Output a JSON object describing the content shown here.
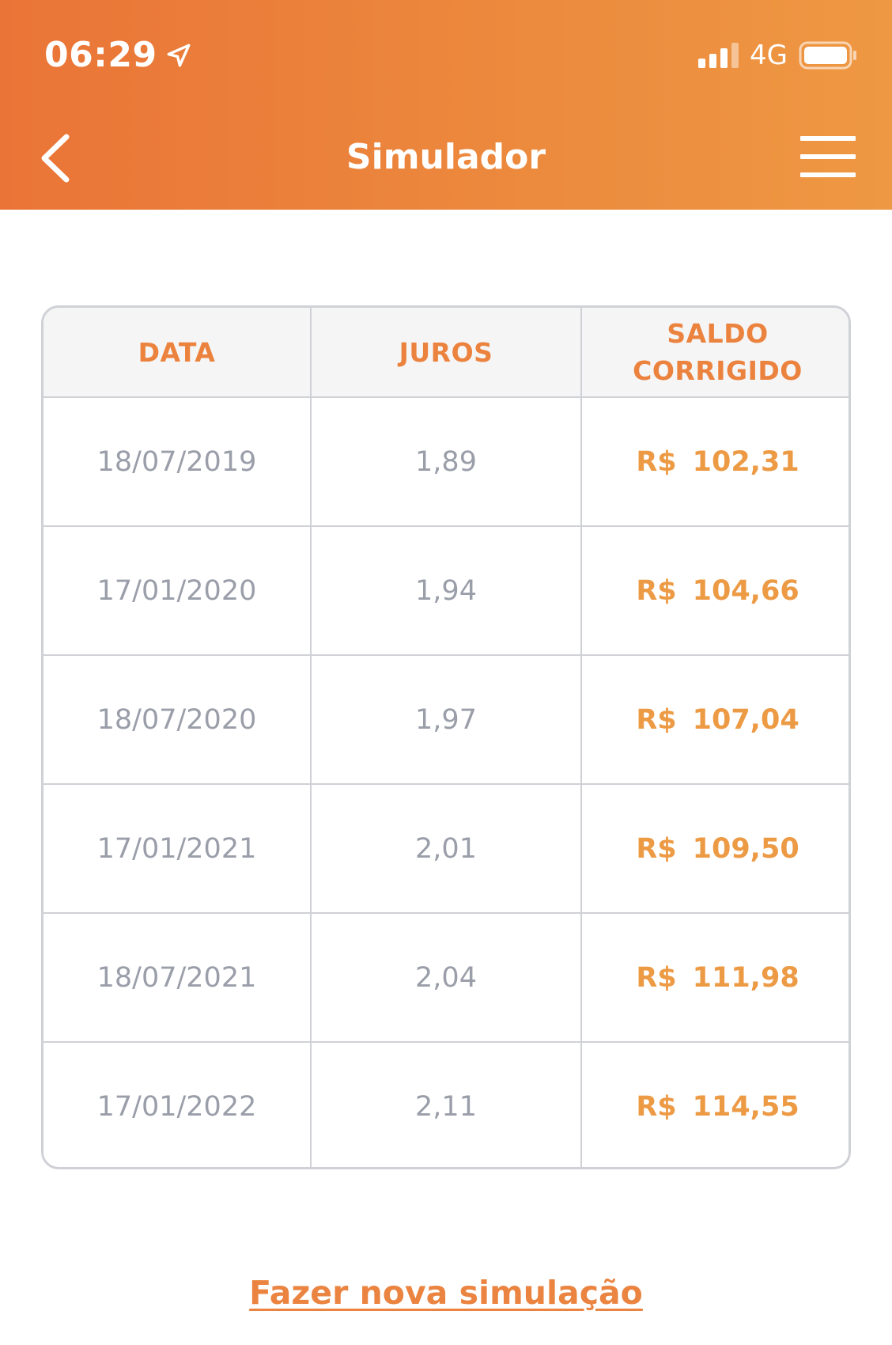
{
  "status_bar": {
    "time": "06:29",
    "network": "4G"
  },
  "header": {
    "title": "Simulador"
  },
  "table": {
    "headers": {
      "date": "DATA",
      "interest": "JUROS",
      "balance_line1": "SALDO",
      "balance_line2": "CORRIGIDO"
    },
    "currency": "R$",
    "rows": [
      {
        "date": "18/07/2019",
        "interest": "1,89",
        "balance": "102,31"
      },
      {
        "date": "17/01/2020",
        "interest": "1,94",
        "balance": "104,66"
      },
      {
        "date": "18/07/2020",
        "interest": "1,97",
        "balance": "107,04"
      },
      {
        "date": "17/01/2021",
        "interest": "2,01",
        "balance": "109,50"
      },
      {
        "date": "18/07/2021",
        "interest": "2,04",
        "balance": "111,98"
      },
      {
        "date": "17/01/2022",
        "interest": "2,11",
        "balance": "114,55"
      }
    ]
  },
  "actions": {
    "new_simulation": "Fazer nova simulação"
  },
  "colors": {
    "header_gradient_start": "#ea7437",
    "header_gradient_end": "#ee9843",
    "accent_orange": "#eb823d",
    "muted_gray": "#9a9ea9",
    "border_gray": "#cfd1d6"
  },
  "icons": {
    "location": "location-arrow-icon",
    "signal": "cellular-signal-icon",
    "battery": "battery-icon",
    "back": "chevron-left-icon",
    "menu": "hamburger-menu-icon"
  }
}
